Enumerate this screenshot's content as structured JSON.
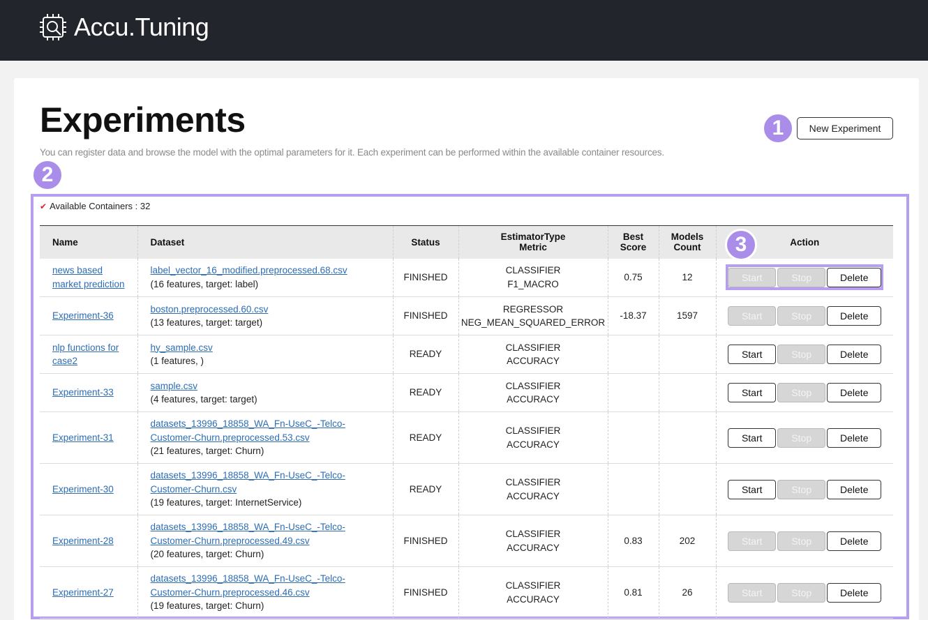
{
  "app": {
    "name": "Accu.Tuning",
    "logo_icon": "chip-gear-icon"
  },
  "page": {
    "title": "Experiments",
    "description": "You can register data and browse the model with the optimal parameters for it. Each experiment can be performed within the available container resources.",
    "new_button": "New Experiment"
  },
  "callouts": [
    "1",
    "2",
    "3"
  ],
  "colors": {
    "header_bg": "#23252d",
    "highlight": "#a98de8",
    "link": "#2d6db5",
    "check": "#e0202a"
  },
  "containers": {
    "label": "Available Containers : 32"
  },
  "table": {
    "headers": {
      "name": "Name",
      "dataset": "Dataset",
      "status": "Status",
      "estimator_1": "EstimatorType",
      "estimator_2": "Metric",
      "score_1": "Best",
      "score_2": "Score",
      "count_1": "Models",
      "count_2": "Count",
      "action": "Action"
    },
    "button_labels": {
      "start": "Start",
      "stop": "Stop",
      "delete": "Delete"
    },
    "rows": [
      {
        "name": "news based market prediction",
        "dataset": "label_vector_16_modified.preprocessed.68.csv",
        "info": "(16 features, target: label)",
        "status": "FINISHED",
        "estimator": "CLASSIFIER",
        "metric": "F1_MACRO",
        "score": "0.75",
        "count": "12",
        "start_enabled": false,
        "stop_enabled": false
      },
      {
        "name": "Experiment-36",
        "dataset": "boston.preprocessed.60.csv",
        "info": "(13 features, target: target)",
        "status": "FINISHED",
        "estimator": "REGRESSOR",
        "metric": "NEG_MEAN_SQUARED_ERROR",
        "score": "-18.37",
        "count": "1597",
        "start_enabled": false,
        "stop_enabled": false
      },
      {
        "name": "nlp functions for case2",
        "dataset": "hy_sample.csv",
        "info": "(1 features, )",
        "status": "READY",
        "estimator": "CLASSIFIER",
        "metric": "ACCURACY",
        "score": "",
        "count": "",
        "start_enabled": true,
        "stop_enabled": false
      },
      {
        "name": "Experiment-33",
        "dataset": "sample.csv",
        "info": "(4 features, target: target)",
        "status": "READY",
        "estimator": "CLASSIFIER",
        "metric": "ACCURACY",
        "score": "",
        "count": "",
        "start_enabled": true,
        "stop_enabled": false
      },
      {
        "name": "Experiment-31",
        "dataset": "datasets_13996_18858_WA_Fn-UseC_-Telco-Customer-Churn.preprocessed.53.csv",
        "info": "(21 features, target: Churn)",
        "status": "READY",
        "estimator": "CLASSIFIER",
        "metric": "ACCURACY",
        "score": "",
        "count": "",
        "start_enabled": true,
        "stop_enabled": false
      },
      {
        "name": "Experiment-30",
        "dataset": "datasets_13996_18858_WA_Fn-UseC_-Telco-Customer-Churn.csv",
        "info": "(19 features, target: InternetService)",
        "status": "READY",
        "estimator": "CLASSIFIER",
        "metric": "ACCURACY",
        "score": "",
        "count": "",
        "start_enabled": true,
        "stop_enabled": false
      },
      {
        "name": "Experiment-28",
        "dataset": "datasets_13996_18858_WA_Fn-UseC_-Telco-Customer-Churn.preprocessed.49.csv",
        "info": "(20 features, target: Churn)",
        "status": "FINISHED",
        "estimator": "CLASSIFIER",
        "metric": "ACCURACY",
        "score": "0.83",
        "count": "202",
        "start_enabled": false,
        "stop_enabled": false
      },
      {
        "name": "Experiment-27",
        "dataset": "datasets_13996_18858_WA_Fn-UseC_-Telco-Customer-Churn.preprocessed.46.csv",
        "info": "(19 features, target: Churn)",
        "status": "FINISHED",
        "estimator": "CLASSIFIER",
        "metric": "ACCURACY",
        "score": "0.81",
        "count": "26",
        "start_enabled": false,
        "stop_enabled": false
      }
    ]
  }
}
